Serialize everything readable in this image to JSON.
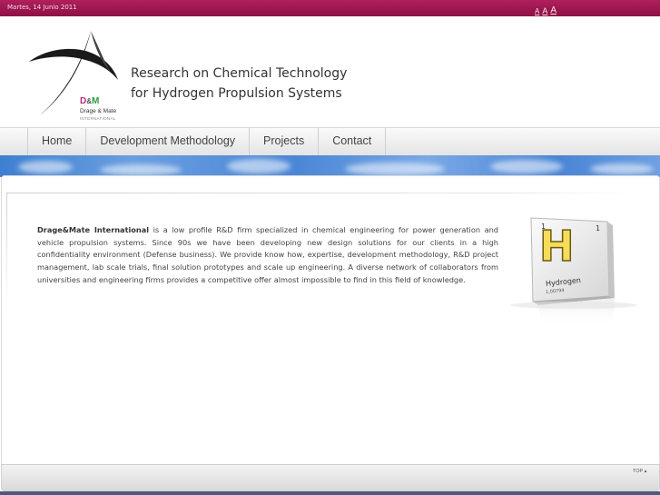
{
  "topbar": {
    "date": "Martes, 14 Junio 2011",
    "font_sizes": [
      "A",
      "A",
      "A"
    ]
  },
  "header": {
    "logo": {
      "initial_d": "D",
      "ampersand": "&",
      "initial_m": "M",
      "name": "Drage & Mate",
      "subtitle": "INTERNATIONAL"
    },
    "tagline_line1": "Research on Chemical Technology",
    "tagline_line2": "for Hydrogen Propulsion Systems"
  },
  "nav": {
    "items": [
      {
        "label": "Home"
      },
      {
        "label": "Development Methodology"
      },
      {
        "label": "Projects"
      },
      {
        "label": "Contact"
      }
    ]
  },
  "main": {
    "intro_company": "Drage&Mate International",
    "intro_text": " is a low profile R&D firm specialized in chemical engineering for power generation and vehicle propulsion systems. Since 90s we have been developing new design solutions for our clients in a high confidentiality environment (Defense business). We provide know how, expertise, development methodology, R&D project management, lab scale trials, final solution prototypes and scale up engineering. A diverse network of collaborators from universities and engineering firms provides a competitive offer almost impossible to find in this field of knowledge.",
    "element_tile": {
      "number_left": "1",
      "number_right": "1",
      "symbol": "H",
      "name": "Hydrogen",
      "mass": "1,00794"
    }
  },
  "footer": {
    "top_link": "TOP ▴"
  },
  "colors": {
    "topbar": "#9c1650",
    "accent_pink": "#c0267a",
    "accent_green": "#2a9d3a",
    "sky_blue": "#4b86d6"
  }
}
